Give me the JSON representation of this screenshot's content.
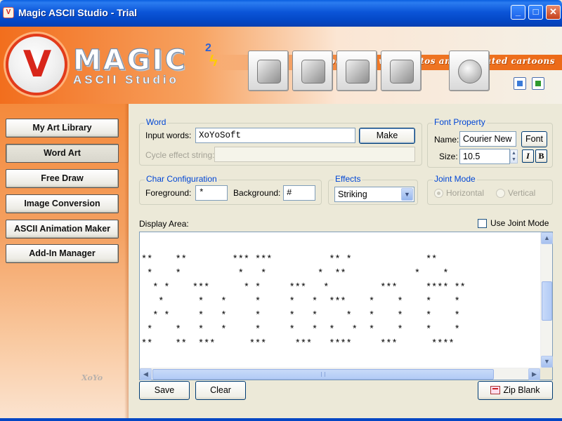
{
  "window": {
    "title": "Magic ASCII Studio - Trial",
    "controls": {
      "minimize": "_",
      "maximize": "□",
      "close": "✕"
    }
  },
  "header": {
    "tagline": "create beautiful web photos and animated cartoons",
    "logo": {
      "main": "MAGIC",
      "superscript": "2",
      "sub": "ASCII Studio"
    }
  },
  "toolbar": {
    "icons": [
      "wizard-icon",
      "folder-icon",
      "image-icon",
      "tools-icon",
      "globe-icon"
    ]
  },
  "sidebar": {
    "items": [
      {
        "label": "My Art Library",
        "active": false
      },
      {
        "label": "Word Art",
        "active": true
      },
      {
        "label": "Free Draw",
        "active": false
      },
      {
        "label": "Image Conversion",
        "active": false
      },
      {
        "label": "ASCII Animation Maker",
        "active": false
      },
      {
        "label": "Add-In Manager",
        "active": false
      }
    ]
  },
  "word": {
    "title": "Word",
    "input_label": "Input words:",
    "input_value": "XoYoSoft",
    "make_button": "Make",
    "cycle_label": "Cycle effect string:",
    "cycle_value": ""
  },
  "font_property": {
    "title": "Font Property",
    "name_label": "Name:",
    "name_value": "Courier New",
    "font_button": "Font",
    "size_label": "Size:",
    "size_value": "10.5",
    "italic_button": "I",
    "bold_button": "B"
  },
  "char_config": {
    "title": "Char Configuration",
    "foreground_label": "Foreground:",
    "foreground_value": "*",
    "background_label": "Background:",
    "background_value": "#"
  },
  "effects": {
    "title": "Effects",
    "selected": "Striking"
  },
  "joint_mode": {
    "title": "Joint Mode",
    "options": [
      "Horizontal",
      "Vertical"
    ],
    "selected": "Horizontal"
  },
  "display": {
    "label": "Display Area:",
    "use_joint_mode_label": "Use Joint Mode",
    "use_joint_mode_checked": false,
    "ascii_art": "**    **        *** ***          ** *             **\n *    *          *   *         *  **            *    *\n  * *    ***      * *     ***   *         ***     **** **\n   *      *   *     *     *   *  ***    *    *    *    *\n  * *     *   *     *     *   *     *   *    *    *    *\n *    *   *   *     *     *   *  *   *  *    *    *    *\n**    **  ***      ***     ***   ****     ***      ****"
  },
  "footer": {
    "save_button": "Save",
    "clear_button": "Clear",
    "zip_blank_button": "Zip Blank"
  },
  "brand": {
    "logo_text": "XoYo"
  }
}
